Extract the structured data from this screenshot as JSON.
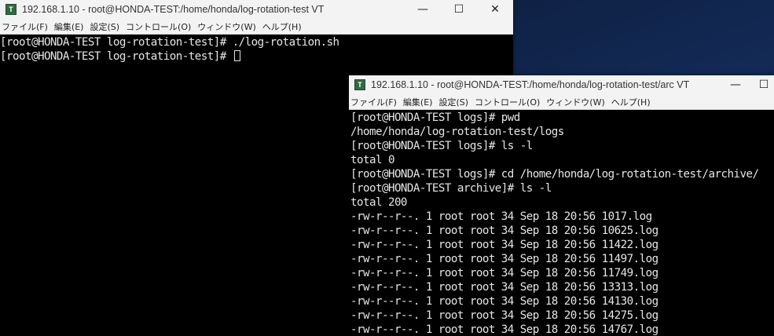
{
  "window1": {
    "title": "192.168.1.10 - root@HONDA-TEST:/home/honda/log-rotation-test VT",
    "controls": {
      "minimize": "—",
      "maximize": "☐",
      "close": "✕"
    },
    "menu": [
      "ファイル(F)",
      "編集(E)",
      "設定(S)",
      "コントロール(O)",
      "ウィンドウ(W)",
      "ヘルプ(H)"
    ],
    "lines": [
      "[root@HONDA-TEST log-rotation-test]# ./log-rotation.sh",
      "[root@HONDA-TEST log-rotation-test]# "
    ]
  },
  "window2": {
    "title": "192.168.1.10 - root@HONDA-TEST:/home/honda/log-rotation-test/arc VT",
    "controls": {
      "minimize": "—",
      "maximize": "☐"
    },
    "menu": [
      "ファイル(F)",
      "編集(E)",
      "設定(S)",
      "コントロール(O)",
      "ウィンドウ(W)",
      "ヘルプ(H)"
    ],
    "lines": [
      "[root@HONDA-TEST logs]# pwd",
      "/home/honda/log-rotation-test/logs",
      "[root@HONDA-TEST logs]# ls -l",
      "total 0",
      "[root@HONDA-TEST logs]# cd /home/honda/log-rotation-test/archive/",
      "[root@HONDA-TEST archive]# ls -l",
      "total 200",
      "-rw-r--r--. 1 root root 34 Sep 18 20:56 1017.log",
      "-rw-r--r--. 1 root root 34 Sep 18 20:56 10625.log",
      "-rw-r--r--. 1 root root 34 Sep 18 20:56 11422.log",
      "-rw-r--r--. 1 root root 34 Sep 18 20:56 11497.log",
      "-rw-r--r--. 1 root root 34 Sep 18 20:56 11749.log",
      "-rw-r--r--. 1 root root 34 Sep 18 20:56 13313.log",
      "-rw-r--r--. 1 root root 34 Sep 18 20:56 14130.log",
      "-rw-r--r--. 1 root root 34 Sep 18 20:56 14275.log",
      "-rw-r--r--. 1 root root 34 Sep 18 20:56 14767.log"
    ]
  }
}
